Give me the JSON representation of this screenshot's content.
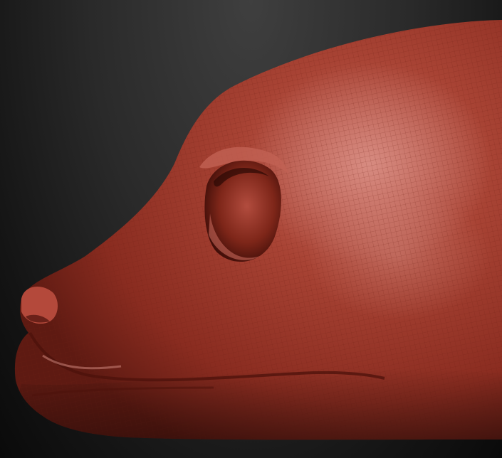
{
  "viewport": {
    "background_top": "#3c3c3c",
    "background_bottom": "#0b0b0b"
  },
  "model": {
    "subject": "sculpted-animal-head-side-view",
    "material_base": "#a8392c",
    "material_highlight": "#d98a80",
    "material_shadow": "#5a1810",
    "wireframe_visible": true,
    "wire_color": "#7a241a"
  }
}
